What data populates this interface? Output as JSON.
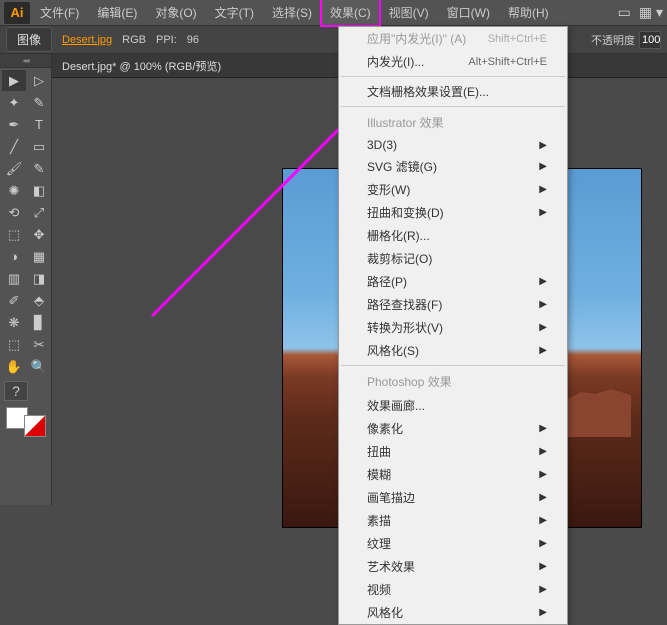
{
  "menubar": {
    "logo": "Ai",
    "items": [
      "文件(F)",
      "编辑(E)",
      "对象(O)",
      "文字(T)",
      "选择(S)",
      "效果(C)",
      "视图(V)",
      "窗口(W)",
      "帮助(H)"
    ]
  },
  "controlbar": {
    "label": "图像",
    "filename": "Desert.jpg",
    "colormode": "RGB",
    "ppi_label": "PPI:",
    "ppi_value": "96",
    "opacity_label": "不透明度",
    "opacity_value": "100"
  },
  "doc_tab": "Desert.jpg* @ 100% (RGB/预览)",
  "dropdown": {
    "apply": "应用\"内发光(I)\"",
    "apply_key": "(A)",
    "apply_shortcut": "Shift+Ctrl+E",
    "reapply": "内发光(I)...",
    "reapply_shortcut": "Alt+Shift+Ctrl+E",
    "docraster": "文档栅格效果设置(E)...",
    "header1": "Illustrator 效果",
    "items1": [
      "3D(3)",
      "SVG 滤镜(G)",
      "变形(W)",
      "扭曲和变换(D)",
      "栅格化(R)...",
      "裁剪标记(O)",
      "路径(P)",
      "路径查找器(F)",
      "转换为形状(V)",
      "风格化(S)"
    ],
    "header2": "Photoshop 效果",
    "items2": [
      "效果画廊...",
      "像素化",
      "扭曲",
      "模糊",
      "画笔描边",
      "素描",
      "纹理",
      "艺术效果",
      "视频",
      "风格化"
    ]
  },
  "tools": {
    "question": "?"
  }
}
